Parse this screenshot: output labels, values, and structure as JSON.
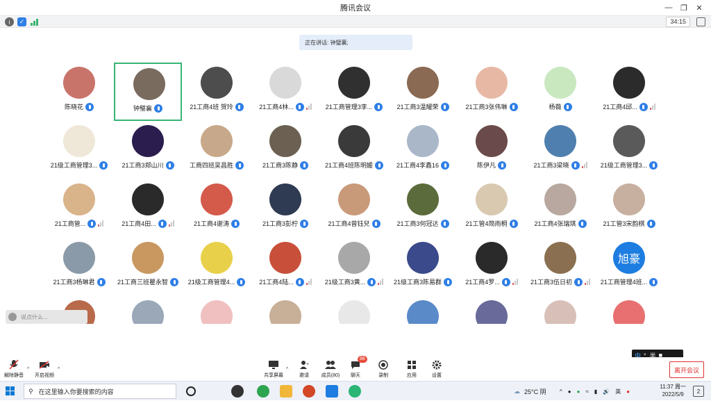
{
  "window": {
    "title": "腾讯会议"
  },
  "status": {
    "timer": "34:15"
  },
  "speaker_banner": "正在讲话: 钟璧襄;",
  "participants": [
    {
      "name": "陈晓花",
      "signal": false,
      "color": "#c9746a"
    },
    {
      "name": "钟璧襄",
      "signal": false,
      "color": "#7a6b5f",
      "active": true
    },
    {
      "name": "21工商4班 贺玲",
      "signal": false,
      "color": "#4d4d4d"
    },
    {
      "name": "21工商4林...",
      "signal": true,
      "color": "#d9d9d9"
    },
    {
      "name": "21工商管理3李...",
      "signal": false,
      "color": "#303030"
    },
    {
      "name": "21工商3温耀荣",
      "signal": false,
      "color": "#8a6a52"
    },
    {
      "name": "21工商3张伟琳",
      "signal": false,
      "color": "#e7b9a5"
    },
    {
      "name": "杨薇",
      "signal": false,
      "color": "#c9e8c0"
    },
    {
      "name": "21工商4邱...",
      "signal": true,
      "color": "#2b2b2b"
    },
    {
      "name": "21级工商管理3...",
      "signal": false,
      "color": "#efe7d8"
    },
    {
      "name": "21工商3郑山川",
      "signal": false,
      "color": "#2b1d4d"
    },
    {
      "name": "工商四班吴昌胜",
      "signal": false,
      "color": "#c8a88a"
    },
    {
      "name": "21工商3陈静",
      "signal": false,
      "color": "#6b6052"
    },
    {
      "name": "21工商4班陈明媛",
      "signal": false,
      "color": "#3a3a3a"
    },
    {
      "name": "21工商4李鑫16",
      "signal": false,
      "color": "#a9b7c9"
    },
    {
      "name": "陈伊凡",
      "signal": false,
      "color": "#6a4a4a"
    },
    {
      "name": "21工商3梁晓",
      "signal": true,
      "color": "#4f7fae"
    },
    {
      "name": "21级工商管理3...",
      "signal": false,
      "color": "#5a5a5a"
    },
    {
      "name": "21工商管...",
      "signal": true,
      "color": "#d9b38a"
    },
    {
      "name": "21工商4田...",
      "signal": true,
      "color": "#2a2a2a"
    },
    {
      "name": "21工商4谢涛",
      "signal": false,
      "color": "#d45a4a"
    },
    {
      "name": "21工商3彭柠",
      "signal": false,
      "color": "#2f3b52"
    },
    {
      "name": "21工商4曾钰兒",
      "signal": false,
      "color": "#c99a7a"
    },
    {
      "name": "21工商3何冠达",
      "signal": false,
      "color": "#5b6b3b"
    },
    {
      "name": "21工管4简雨桐",
      "signal": false,
      "color": "#d8c9b0"
    },
    {
      "name": "21工商4张瑞琪",
      "signal": false,
      "color": "#b8a8a0"
    },
    {
      "name": "21工管3宋韵棋",
      "signal": false,
      "color": "#c8b0a0"
    },
    {
      "name": "21工商3杨琳君",
      "signal": false,
      "color": "#8a9aa8"
    },
    {
      "name": "21工商三班瞿永智",
      "signal": false,
      "color": "#c89860"
    },
    {
      "name": "21级工商管理4...",
      "signal": false,
      "color": "#e8d04a"
    },
    {
      "name": "21工商4陆...",
      "signal": true,
      "color": "#c8503a"
    },
    {
      "name": "21级工商3黄...",
      "signal": true,
      "color": "#a8a8a8"
    },
    {
      "name": "21级工商3陈易群",
      "signal": false,
      "color": "#3a4a8a"
    },
    {
      "name": "21工商4罗...",
      "signal": true,
      "color": "#2a2a2a"
    },
    {
      "name": "21工商3伍日初",
      "signal": true,
      "color": "#8a7050"
    },
    {
      "name": "21工商管理4班...",
      "signal": false,
      "color": "#1d7de0",
      "text": "旭豪"
    },
    {
      "name": "",
      "color": "#b86a4a"
    },
    {
      "name": "",
      "color": "#9aa8b8"
    },
    {
      "name": "",
      "color": "#f0c0c0"
    },
    {
      "name": "",
      "color": "#c8b098"
    },
    {
      "name": "",
      "color": "#e8e8e8"
    },
    {
      "name": "",
      "color": "#5a8ac8"
    },
    {
      "name": "",
      "color": "#6a6a9a"
    },
    {
      "name": "",
      "color": "#d8c0b8"
    },
    {
      "name": "",
      "color": "#e87070"
    }
  ],
  "chat_input": {
    "placeholder": "说点什么..."
  },
  "toolbar": {
    "mute": "解除静音",
    "video": "开启视频",
    "share": "共享屏幕",
    "invite": "邀请",
    "members": "成员(80)",
    "chat": "聊天",
    "chat_badge": "88",
    "record": "录制",
    "apps": "应用",
    "settings": "设置",
    "leave": "离开会议"
  },
  "ime": {
    "mode": "中",
    "rest": "°, 半"
  },
  "taskbar": {
    "search_placeholder": "在这里输入你要搜索的内容",
    "weather": "25°C 阴",
    "time": "11:37 周一",
    "date": "2022/5/9",
    "notifications": "2"
  }
}
